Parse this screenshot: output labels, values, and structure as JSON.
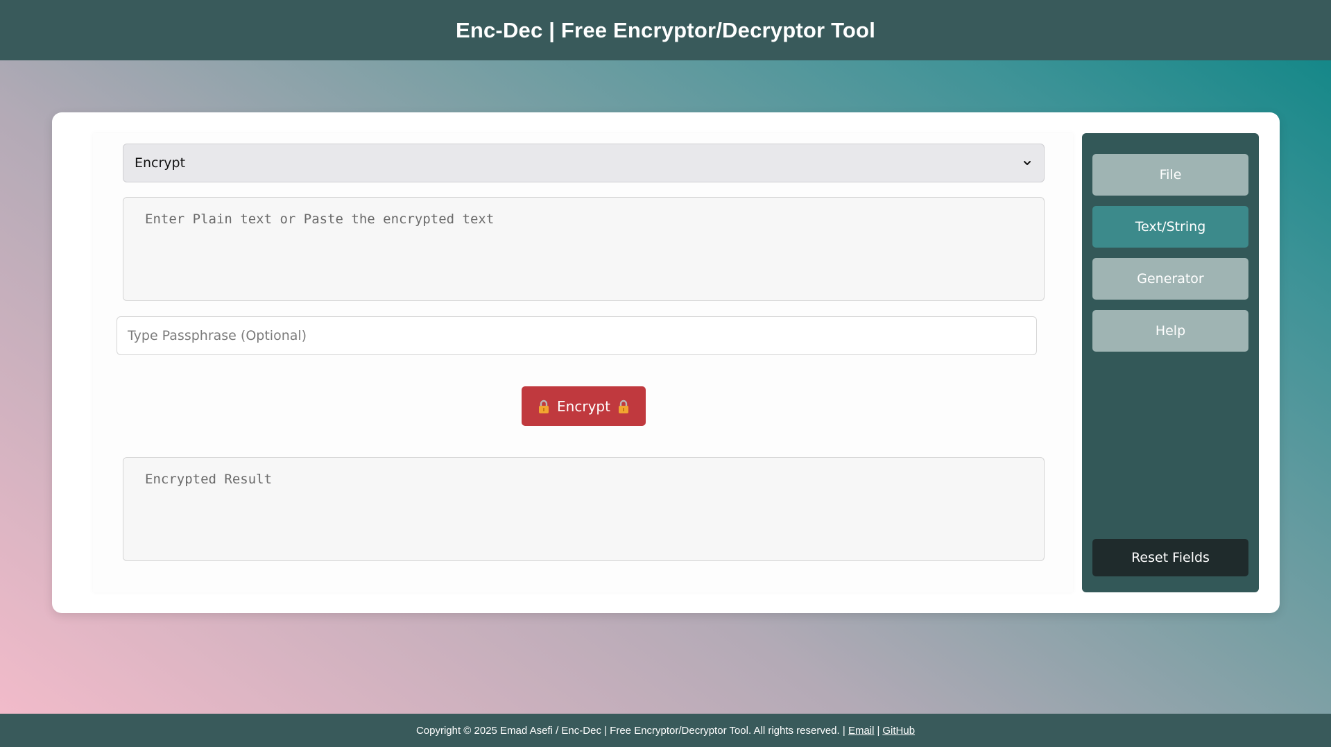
{
  "header": {
    "title": "Enc-Dec | Free Encryptor/Decryptor Tool"
  },
  "form": {
    "mode_selected": "Encrypt",
    "input_placeholder": "Enter Plain text or Paste the encrypted text",
    "passphrase_placeholder": "Type Passphrase (Optional)",
    "action_label": "Encrypt",
    "result_placeholder": "Encrypted Result"
  },
  "sidebar": {
    "items": [
      {
        "label": "File",
        "active": false
      },
      {
        "label": "Text/String",
        "active": true
      },
      {
        "label": "Generator",
        "active": false
      },
      {
        "label": "Help",
        "active": false
      }
    ],
    "reset_label": "Reset Fields"
  },
  "footer": {
    "copyright": "Copyright © 2025 Emad Asefi / Enc-Dec | Free Encryptor/Decryptor Tool. All rights reserved. |",
    "email_label": "Email",
    "separator": "|",
    "github_label": "GitHub"
  },
  "colors": {
    "header_bg": "#395a5b",
    "action_button": "#c0393e",
    "sidebar_bg": "#335858",
    "sidebar_active": "#3c8a8b",
    "sidebar_inactive": "#9fb4b3",
    "reset_button": "#1f2b2c"
  },
  "icons": {
    "dropdown": "chevron-down-icon",
    "lock": "lock-icon"
  }
}
